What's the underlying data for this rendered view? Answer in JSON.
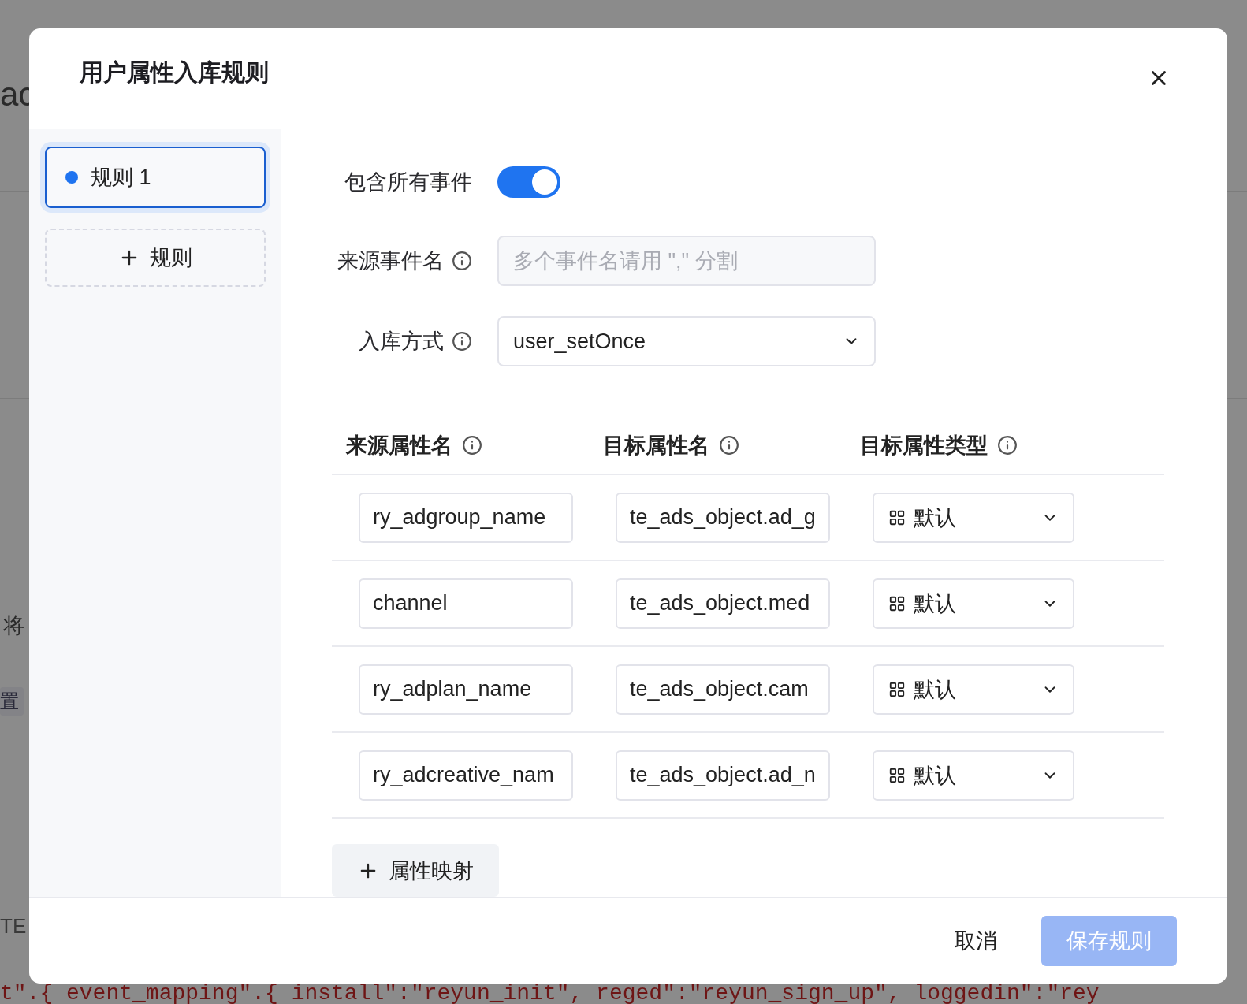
{
  "background": {
    "fragments": [
      {
        "kind": "heading",
        "text": "ac"
      },
      {
        "kind": "text",
        "text": "将"
      },
      {
        "kind": "tag",
        "text": "置"
      },
      {
        "kind": "small",
        "text": "TE"
      }
    ],
    "code_line": "t\".{ event_mapping\".{ install\":\"reyun_init\", reged\":\"reyun_sign_up\", loggedin\":\"rey"
  },
  "dialog": {
    "title": "用户属性入库规则",
    "rules": [
      {
        "label": "规则 1",
        "selected": true
      }
    ],
    "add_rule": "规则",
    "form": {
      "include_all_events": {
        "label": "包含所有事件",
        "on": true
      },
      "source_events": {
        "label": "来源事件名",
        "placeholder": "多个事件名请用 \",\" 分割"
      },
      "storage_mode": {
        "label": "入库方式",
        "value": "user_setOnce"
      }
    },
    "mapping": {
      "columns": [
        "来源属性名",
        "目标属性名",
        "目标属性类型"
      ],
      "rows": [
        {
          "source": "ry_adgroup_name",
          "target": "te_ads_object.ad_g",
          "type": "默认"
        },
        {
          "source": "channel",
          "target": "te_ads_object.med",
          "type": "默认"
        },
        {
          "source": "ry_adplan_name",
          "target": "te_ads_object.cam",
          "type": "默认"
        },
        {
          "source": "ry_adcreative_nam",
          "target": "te_ads_object.ad_n",
          "type": "默认"
        }
      ],
      "add_button": "属性映射"
    },
    "footer": {
      "cancel": "取消",
      "save": {
        "label": "保存规则",
        "disabled": true
      }
    }
  }
}
